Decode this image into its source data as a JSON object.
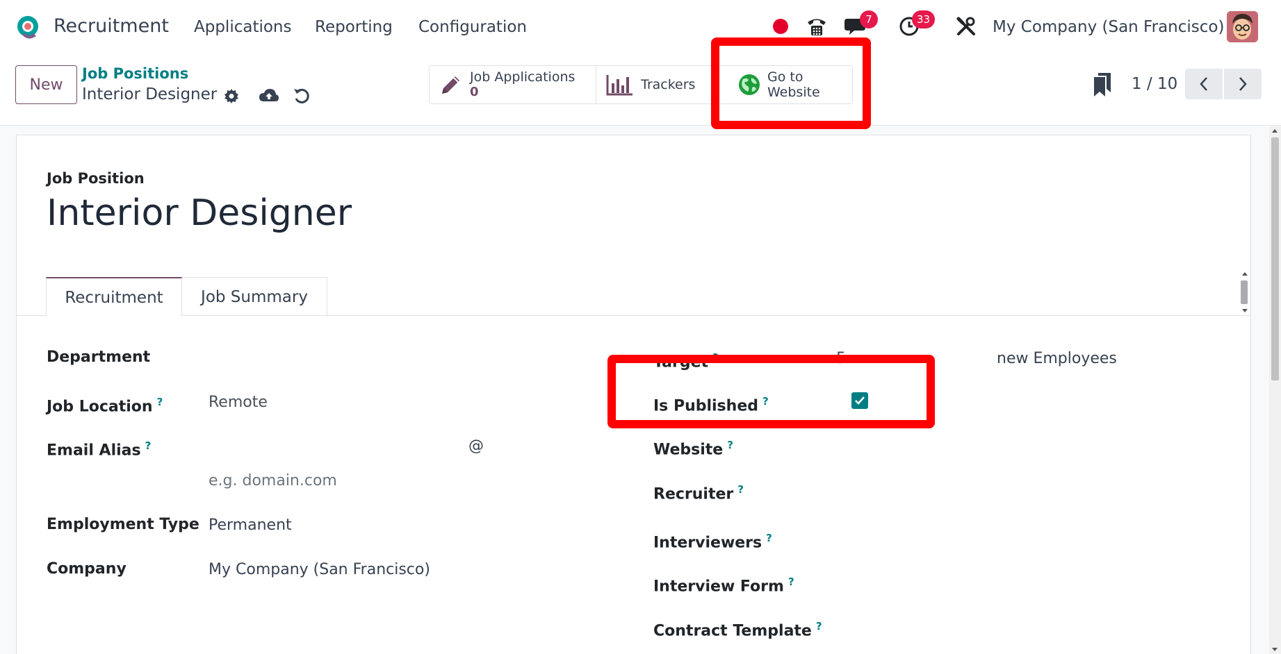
{
  "navbar": {
    "app_name": "Recruitment",
    "menu": [
      "Applications",
      "Reporting",
      "Configuration"
    ],
    "messages_badge": "7",
    "activities_badge": "33",
    "company": "My Company (San Francisco)",
    "icons": [
      "odoo-logo-icon",
      "record-dot-icon",
      "phone-icon",
      "chat-icon",
      "clock-icon",
      "tools-icon",
      "avatar"
    ]
  },
  "control_panel": {
    "new_label": "New",
    "breadcrumb_parent": "Job Positions",
    "record_name": "Interior Designer",
    "smart_buttons": {
      "job_applications_label": "Job Applications",
      "job_applications_count": "0",
      "trackers_label": "Trackers",
      "website_label_line1": "Go to",
      "website_label_line2": "Website"
    },
    "pager": "1 / 10"
  },
  "form": {
    "title_label": "Job Position",
    "title": "Interior Designer",
    "tabs": [
      "Recruitment",
      "Job Summary"
    ],
    "left": {
      "department_label": "Department",
      "job_location_label": "Job Location",
      "job_location_value": "Remote",
      "email_alias_label": "Email Alias",
      "email_at": "@",
      "email_domain_placeholder": "e.g. domain.com",
      "employment_type_label": "Employment Type",
      "employment_type_value": "Permanent",
      "company_label": "Company",
      "company_value": "My Company (San Francisco)"
    },
    "right": {
      "target_label": "Target",
      "target_value": "5",
      "target_suffix": "new Employees",
      "is_published_label": "Is Published",
      "is_published": true,
      "website_label": "Website",
      "recruiter_label": "Recruiter",
      "interviewers_label": "Interviewers",
      "interview_form_label": "Interview Form",
      "contract_template_label": "Contract Template"
    },
    "help_mark": "?"
  },
  "colors": {
    "brand": "#714b67",
    "teal": "#017e84",
    "highlight": "#ff0000",
    "badge": "#e5194b"
  }
}
